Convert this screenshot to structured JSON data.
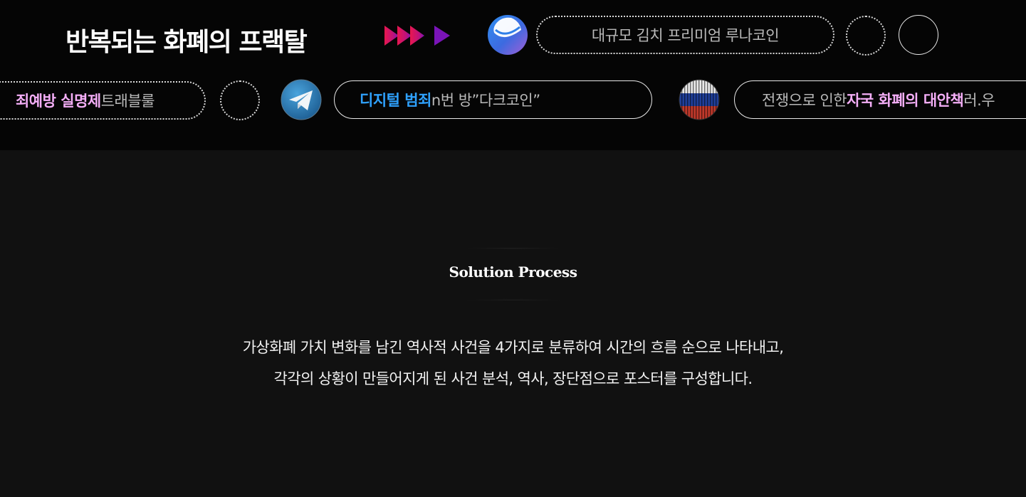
{
  "header": {
    "title": "반복되는 화폐의 프랙탈"
  },
  "row1": {
    "pill_luna": "대규모 김치 프리미엄 루나코인"
  },
  "row2": {
    "pill_trouble": {
      "highlight": "죄예방 실명제",
      "rest": " 트래블룰"
    },
    "pill_darkcoin": {
      "highlight": "디지털 범죄",
      "rest": " n번 방”다크코인”"
    },
    "pill_war": {
      "prefix": "전쟁으로 인한 ",
      "highlight": "자국 화폐의 대안책",
      "suffix": " 러.우"
    }
  },
  "section": {
    "heading": "Solution Process",
    "description_line1": "가상화폐 가치 변화를 남긴 역사적 사건을 4가지로 분류하여 시간의 흐름 순으로 나타내고,",
    "description_line2": "각각의 상황이 만들어지게 된 사건 분석, 역사, 장단점으로 포스터를 구성합니다."
  },
  "icons": {
    "luna": "luna-coin-icon",
    "telegram": "telegram-icon",
    "russia_flag": "russia-flag-icon",
    "arrows": "play-arrows-icon"
  },
  "colors": {
    "pink_highlight": "#f4aef7",
    "blue_highlight": "#2fa2ff",
    "arrow_red": "#e8174f",
    "arrow_purple": "#7a14b8"
  }
}
